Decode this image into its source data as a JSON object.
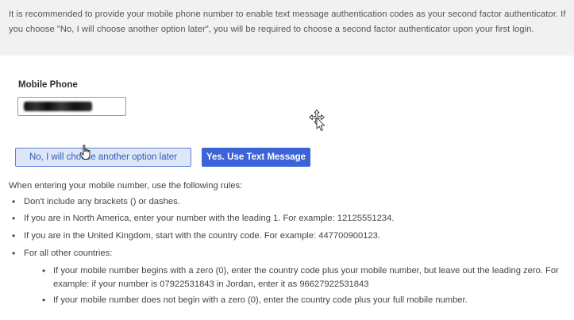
{
  "intro": {
    "text": "It is recommended to provide your mobile phone number to enable text message authentication codes as your second factor authenticator. If you choose \"No, I will choose another option later\", you will be required to choose a second factor authenticator upon your first login."
  },
  "phone": {
    "label": "Mobile Phone",
    "value": "",
    "redacted": true
  },
  "buttons": {
    "decline_label": "No, I will choose another option later",
    "accept_label": "Yes. Use Text Message"
  },
  "rules": {
    "intro": "When entering your mobile number, use the following rules:",
    "items": [
      "Don't include any brackets () or dashes.",
      "If you are in North America, enter your number with the leading 1. For example: 12125551234.",
      "If you are in the United Kingdom, start with the country code. For example: 447700900123.",
      "For all other countries:"
    ],
    "sub_items": [
      "If your mobile number begins with a zero (0), enter the country code plus your mobile number, but leave out the leading zero. For example: if your number is 07922531843 in Jordan, enter it as 96627922531843",
      "If your mobile number does not begin with a zero (0), enter the country code plus your full mobile number."
    ]
  },
  "colors": {
    "primary_button": "#3d63d9",
    "secondary_button_bg": "#dde7f8",
    "secondary_button_border": "#5c80d6",
    "intro_background": "#f1f1f1"
  },
  "icons": {
    "hand_cursor": "hand-pointer-icon",
    "move_cursor": "move-cursor-icon"
  }
}
